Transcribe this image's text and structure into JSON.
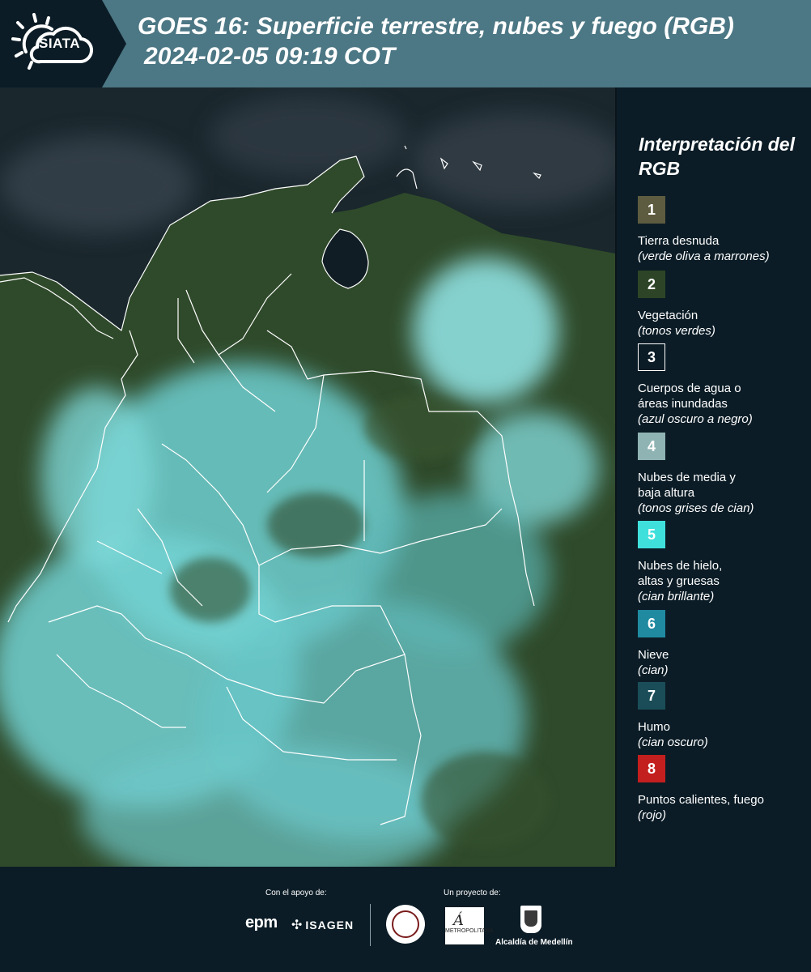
{
  "header": {
    "logo_text": "SIATA",
    "title_line1": "GOES 16: Superficie terrestre, nubes y fuego (RGB)",
    "title_line2": "2024-02-05 09:19 COT"
  },
  "legend": {
    "title": "Interpretación del RGB",
    "items": [
      {
        "number": "1",
        "color": "#5e5c40",
        "label": "Tierra desnuda",
        "note": "(verde oliva a marrones)"
      },
      {
        "number": "2",
        "color": "#2d4526",
        "label": "Vegetación",
        "note": "(tonos verdes)"
      },
      {
        "number": "3",
        "color": "#0b1c26",
        "label": "Cuerpos de agua o áreas inundadas",
        "note": "(azul oscuro a negro)"
      },
      {
        "number": "4",
        "color": "#8fb3b3",
        "label": "Nubes de media y baja altura",
        "note": "(tonos grises de cian)"
      },
      {
        "number": "5",
        "color": "#3fe0dc",
        "label": "Nubes de hielo, altas y gruesas",
        "note": "(cian brillante)"
      },
      {
        "number": "6",
        "color": "#1f8aa0",
        "label": "Nieve",
        "note": "(cian)"
      },
      {
        "number": "7",
        "color": "#1a4d57",
        "label": "Humo",
        "note": "(cian oscuro)"
      },
      {
        "number": "8",
        "color": "#c41f1f",
        "label": "Puntos calientes, fuego",
        "note": "(rojo)"
      }
    ]
  },
  "footer": {
    "support_label": "Con el apoyo de:",
    "project_label": "Un proyecto de:",
    "epm": "epm",
    "isagen": "ISAGEN",
    "area_logo": "METROPOLITANA",
    "medellin": "Alcaldía de Medellín"
  },
  "colors": {
    "header_bg": "#4c7784",
    "panel_bg": "#0b1c26",
    "ocean": "#17262d",
    "vegetation": "#2f4a2a",
    "cloud": "#7fd3d3",
    "border_lines": "#ffffff"
  }
}
